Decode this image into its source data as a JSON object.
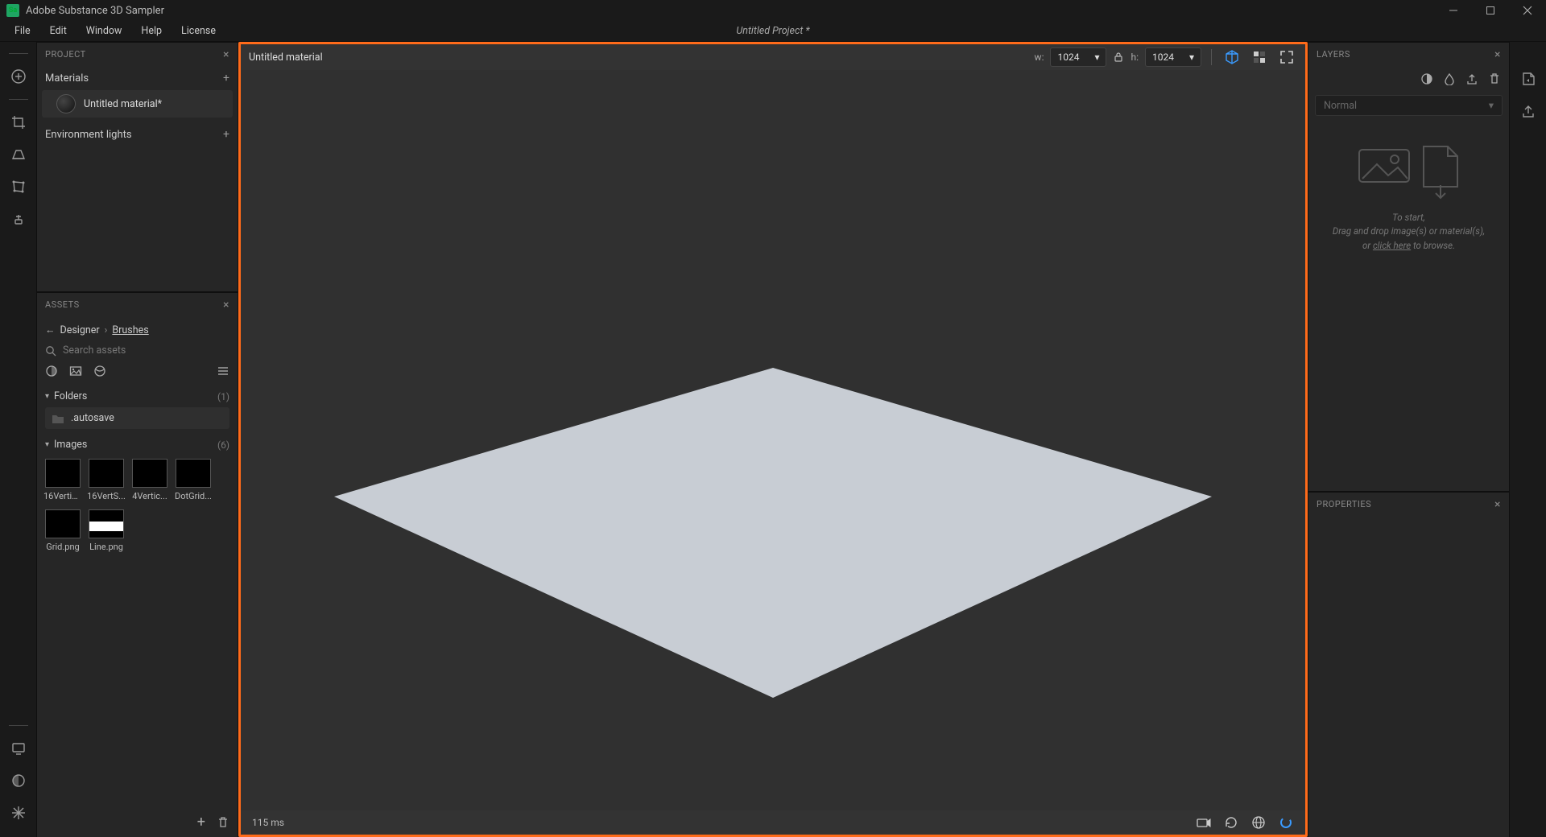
{
  "app": {
    "title": "Adobe Substance 3D Sampler",
    "logo_text": "Sa"
  },
  "menu": {
    "file": "File",
    "edit": "Edit",
    "window": "Window",
    "help": "Help",
    "license": "License",
    "project_title": "Untitled Project *"
  },
  "left_rail": {
    "tools": [
      "add",
      "crop",
      "perspective",
      "warp",
      "clone"
    ],
    "bottom": [
      "monitor",
      "globe",
      "snowflake"
    ]
  },
  "project_panel": {
    "title": "PROJECT",
    "materials_label": "Materials",
    "material_item": "Untitled material*",
    "env_label": "Environment lights"
  },
  "assets_panel": {
    "title": "ASSETS",
    "breadcrumb": {
      "root": "Designer",
      "leaf": "Brushes"
    },
    "search_placeholder": "Search assets",
    "folders_label": "Folders",
    "folders_count": "(1)",
    "folder_item": ".autosave",
    "images_label": "Images",
    "images_count": "(6)",
    "thumbs": [
      {
        "name": "16Vertic..."
      },
      {
        "name": "16VertS..."
      },
      {
        "name": "4Vertic..."
      },
      {
        "name": "DotGrid..."
      },
      {
        "name": "Grid.png"
      },
      {
        "name": "Line.png"
      }
    ]
  },
  "viewport": {
    "material_name": "Untitled material",
    "w_label": "w:",
    "h_label": "h:",
    "width_value": "1024",
    "height_value": "1024",
    "render_time": "115 ms"
  },
  "layers_panel": {
    "title": "LAYERS",
    "blend_mode": "Normal",
    "drop_line1": "To start,",
    "drop_line2_a": "Drag and drop image(s) or material(s),",
    "drop_line3_a": "or ",
    "drop_link": "click here",
    "drop_line3_b": " to browse."
  },
  "properties_panel": {
    "title": "PROPERTIES"
  },
  "right_rail": {
    "tools": [
      "import",
      "export"
    ]
  }
}
